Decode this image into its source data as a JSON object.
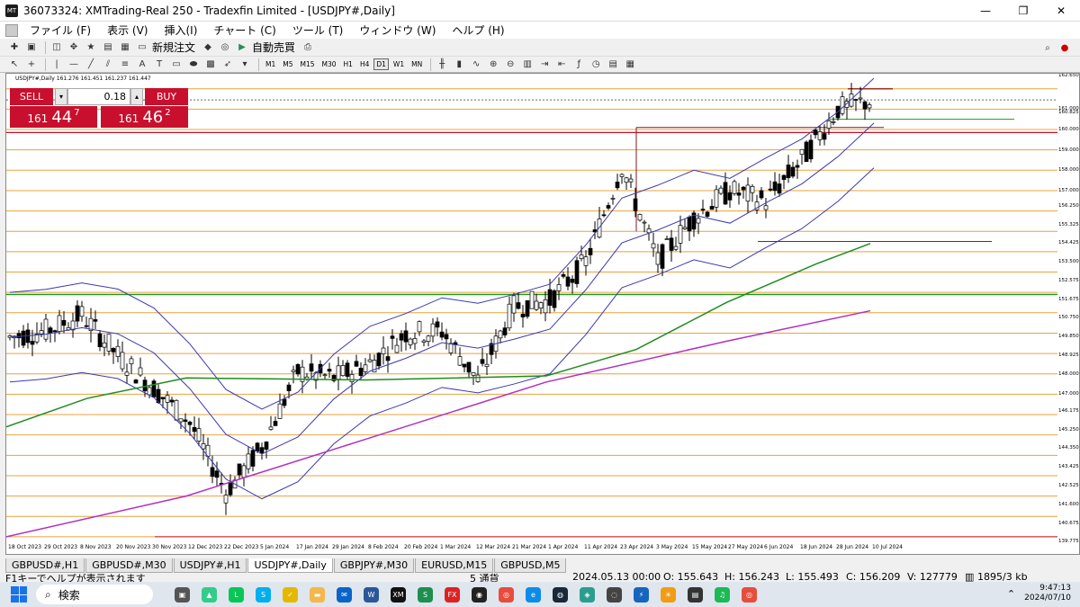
{
  "window": {
    "title": "36073324: XMTrading-Real 250 - Tradexfin Limited - [USDJPY#,Daily]",
    "minimize": "—",
    "maximize": "❐",
    "close": "✕"
  },
  "menu": [
    "ファイル (F)",
    "表示 (V)",
    "挿入(I)",
    "チャート (C)",
    "ツール (T)",
    "ウィンドウ (W)",
    "ヘルプ (H)"
  ],
  "toolbar": {
    "new_order": "新規注文",
    "auto_trade": "自動売買",
    "timeframes": [
      "M1",
      "M5",
      "M15",
      "M30",
      "H1",
      "H4",
      "D1",
      "W1",
      "MN"
    ],
    "active_timeframe": "D1"
  },
  "chart": {
    "symbol_info": "USDJPY#,Daily  161.276 161.451 161.237 161.447",
    "trade_panel": {
      "sell_label": "SELL",
      "buy_label": "BUY",
      "lot": "0.18",
      "sell_price_small": "161",
      "sell_price_big": "44",
      "sell_price_sup": "7",
      "buy_price_small": "161",
      "buy_price_big": "46",
      "buy_price_sup": "2"
    },
    "price_labels": [
      "162.650",
      "161.000",
      "160.825",
      "160.000",
      "159.000",
      "158.000",
      "157.000",
      "156.250",
      "155.325",
      "154.425",
      "153.500",
      "152.575",
      "151.675",
      "150.750",
      "149.850",
      "148.925",
      "148.000",
      "147.000",
      "146.175",
      "145.250",
      "144.350",
      "143.425",
      "142.525",
      "141.600",
      "140.675",
      "139.775"
    ],
    "date_labels": [
      "18 Oct 2023",
      "29 Oct 2023",
      "8 Nov 2023",
      "20 Nov 2023",
      "30 Nov 2023",
      "12 Dec 2023",
      "22 Dec 2023",
      "5 Jan 2024",
      "17 Jan 2024",
      "29 Jan 2024",
      "8 Feb 2024",
      "20 Feb 2024",
      "1 Mar 2024",
      "12 Mar 2024",
      "21 Mar 2024",
      "1 Apr 2024",
      "11 Apr 2024",
      "23 Apr 2024",
      "3 May 2024",
      "15 May 2024",
      "27 May 2024",
      "6 Jun 2024",
      "18 Jun 2024",
      "28 Jun 2024",
      "10 Jul 2024"
    ]
  },
  "tabs": [
    "GBPUSD#,H1",
    "GBPUSD#,M30",
    "USDJPY#,H1",
    "USDJPY#,Daily",
    "GBPJPY#,M30",
    "EURUSD,M15",
    "GBPUSD,M5"
  ],
  "active_tab": "USDJPY#,Daily",
  "status": {
    "help": "F1キーでヘルプが表示されます",
    "profile": "5 通貨",
    "datetime": "2024.05.13 00:00",
    "open": "O: 155.643",
    "high": "H: 156.243",
    "low": "L: 155.493",
    "close": "C: 156.209",
    "volume": "V: 127779",
    "traffic": "1895/3 kb"
  },
  "taskbar": {
    "search_placeholder": "検索",
    "time": "9:47:13",
    "date": "2024/07/10"
  },
  "chart_data": {
    "type": "candlestick",
    "symbol": "USDJPY#",
    "timeframe": "Daily",
    "last": {
      "open": 161.276,
      "high": 161.451,
      "low": 161.237,
      "close": 161.447
    },
    "ylim": [
      139.775,
      162.65
    ],
    "x": [
      "18 Oct 2023",
      "29 Oct 2023",
      "8 Nov 2023",
      "20 Nov 2023",
      "30 Nov 2023",
      "12 Dec 2023",
      "22 Dec 2023",
      "5 Jan 2024",
      "17 Jan 2024",
      "29 Jan 2024",
      "8 Feb 2024",
      "20 Feb 2024",
      "1 Mar 2024",
      "12 Mar 2024",
      "21 Mar 2024",
      "1 Apr 2024",
      "11 Apr 2024",
      "23 Apr 2024",
      "3 May 2024",
      "15 May 2024",
      "27 May 2024",
      "6 Jun 2024",
      "18 Jun 2024",
      "28 Jun 2024",
      "10 Jul 2024"
    ],
    "close": [
      149.8,
      150.1,
      150.9,
      148.9,
      147.3,
      145.6,
      142.2,
      144.4,
      148.1,
      147.8,
      148.5,
      150.0,
      150.1,
      147.7,
      151.3,
      151.6,
      153.5,
      158.2,
      153.5,
      155.7,
      157.0,
      156.5,
      158.5,
      161.0,
      161.45
    ]
  }
}
